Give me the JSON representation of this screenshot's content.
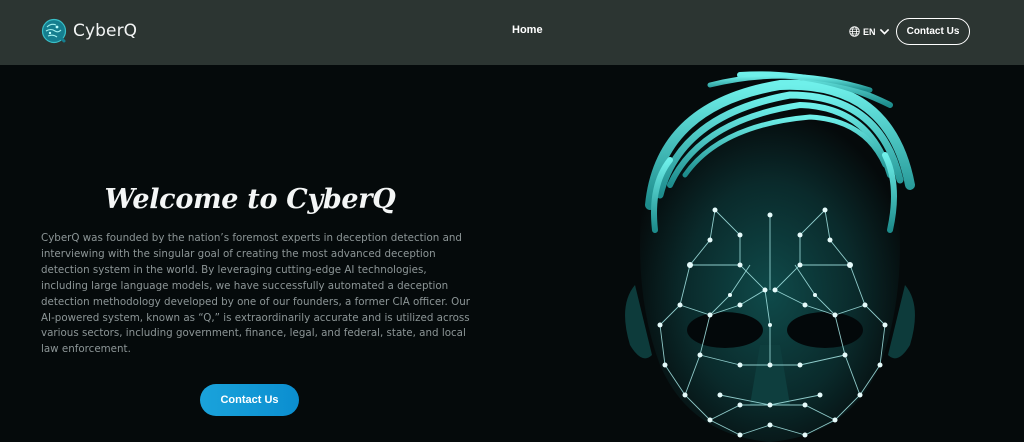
{
  "nav": {
    "brand": "CyberQ",
    "home_label": "Home",
    "language": "EN",
    "contact_label": "Contact Us"
  },
  "hero": {
    "title": "Welcome to CyberQ",
    "body": "CyberQ was founded by the nation’s foremost experts in deception detection and interviewing with the singular goal of creating the most advanced deception detection system in the world. By leveraging cutting-edge AI technologies, including large language models, we have successfully automated a deception detection methodology developed by one of our founders, a former CIA officer. Our AI-powered system, known as “Q,” is extraordinarily accurate and is utilized across various sectors, including government, finance, legal, and federal, state, and local law enforcement.",
    "cta_label": "Contact Us"
  },
  "icons": {
    "logo": "cyberq-logo-icon",
    "language": "globe-icon",
    "language_caret": "chevron-down-icon"
  },
  "colors": {
    "navbar": "#2c3532",
    "background": "#050a0b",
    "accent": "#49d1cc",
    "cta": "#1aa3db"
  }
}
